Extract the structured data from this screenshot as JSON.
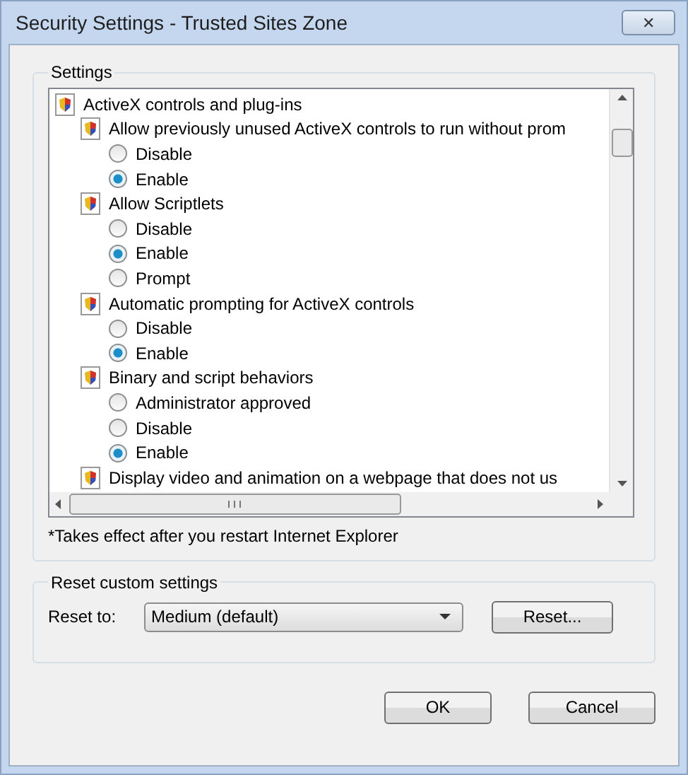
{
  "window": {
    "title": "Security Settings - Trusted Sites Zone",
    "close": "✕"
  },
  "settings": {
    "legend": "Settings",
    "tree": [
      {
        "label": "ActiveX controls and plug-ins",
        "children": [
          {
            "label": "Allow previously unused ActiveX controls to run without prom",
            "options": [
              {
                "label": "Disable",
                "selected": false
              },
              {
                "label": "Enable",
                "selected": true
              }
            ]
          },
          {
            "label": "Allow Scriptlets",
            "options": [
              {
                "label": "Disable",
                "selected": false
              },
              {
                "label": "Enable",
                "selected": true
              },
              {
                "label": "Prompt",
                "selected": false
              }
            ]
          },
          {
            "label": "Automatic prompting for ActiveX controls",
            "options": [
              {
                "label": "Disable",
                "selected": false
              },
              {
                "label": "Enable",
                "selected": true
              }
            ]
          },
          {
            "label": "Binary and script behaviors",
            "options": [
              {
                "label": "Administrator approved",
                "selected": false
              },
              {
                "label": "Disable",
                "selected": false
              },
              {
                "label": "Enable",
                "selected": true
              }
            ]
          },
          {
            "label": "Display video and animation on a webpage that does not us"
          }
        ]
      }
    ],
    "note": "*Takes effect after you restart Internet Explorer"
  },
  "reset": {
    "legend": "Reset custom settings",
    "label": "Reset to:",
    "value": "Medium (default)",
    "button": "Reset..."
  },
  "buttons": [
    "OK",
    "Cancel"
  ]
}
